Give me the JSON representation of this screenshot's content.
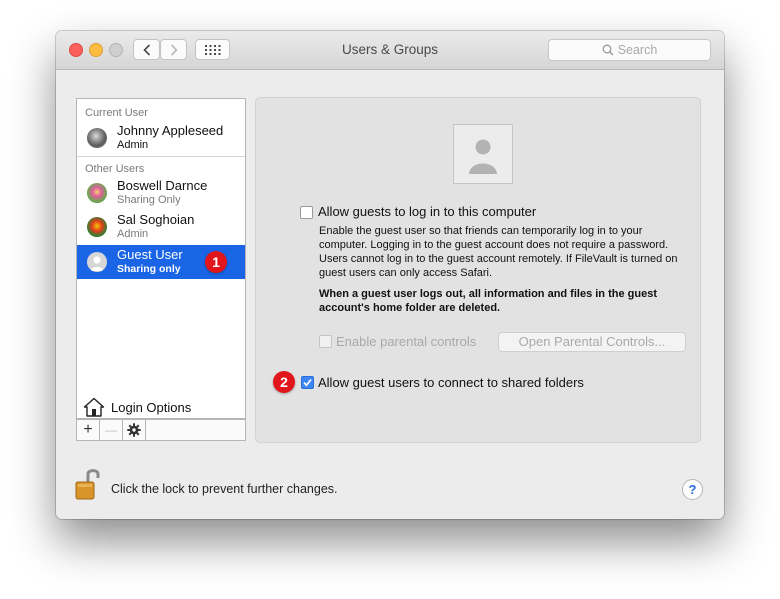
{
  "window": {
    "title": "Users & Groups",
    "search_placeholder": "Search"
  },
  "sidebar": {
    "current_header": "Current User",
    "current_user": {
      "name": "Johnny Appleseed",
      "role": "Admin"
    },
    "other_header": "Other Users",
    "other_users": [
      {
        "name": "Boswell Darnce",
        "role": "Sharing Only"
      },
      {
        "name": "Sal Soghoian",
        "role": "Admin"
      },
      {
        "name": "Guest User",
        "role": "Sharing only"
      }
    ],
    "login_options": "Login Options",
    "add_label": "+",
    "remove_label": "—"
  },
  "badges": {
    "one": "1",
    "two": "2"
  },
  "panel": {
    "allow_login_label": "Allow guests to log in to this computer",
    "allow_login_checked": false,
    "description": "Enable the guest user so that friends can temporarily log in to your computer. Logging in to the guest account does not require a password. Users cannot log in to the guest account remotely. If FileVault is turned on guest users can only access Safari.",
    "warning": "When a guest user logs out, all information and files in the guest account's home folder are deleted.",
    "parental_label": "Enable parental controls",
    "parental_checked": false,
    "open_parental_button": "Open Parental Controls...",
    "shared_folders_label": "Allow guest users to connect to shared folders",
    "shared_folders_checked": true
  },
  "footer": {
    "lock_text": "Click the lock to prevent further changes.",
    "help_label": "?"
  },
  "colors": {
    "selection": "#1a64e6",
    "badge": "#e1161c",
    "checkbox_on": "#3d86f4"
  }
}
